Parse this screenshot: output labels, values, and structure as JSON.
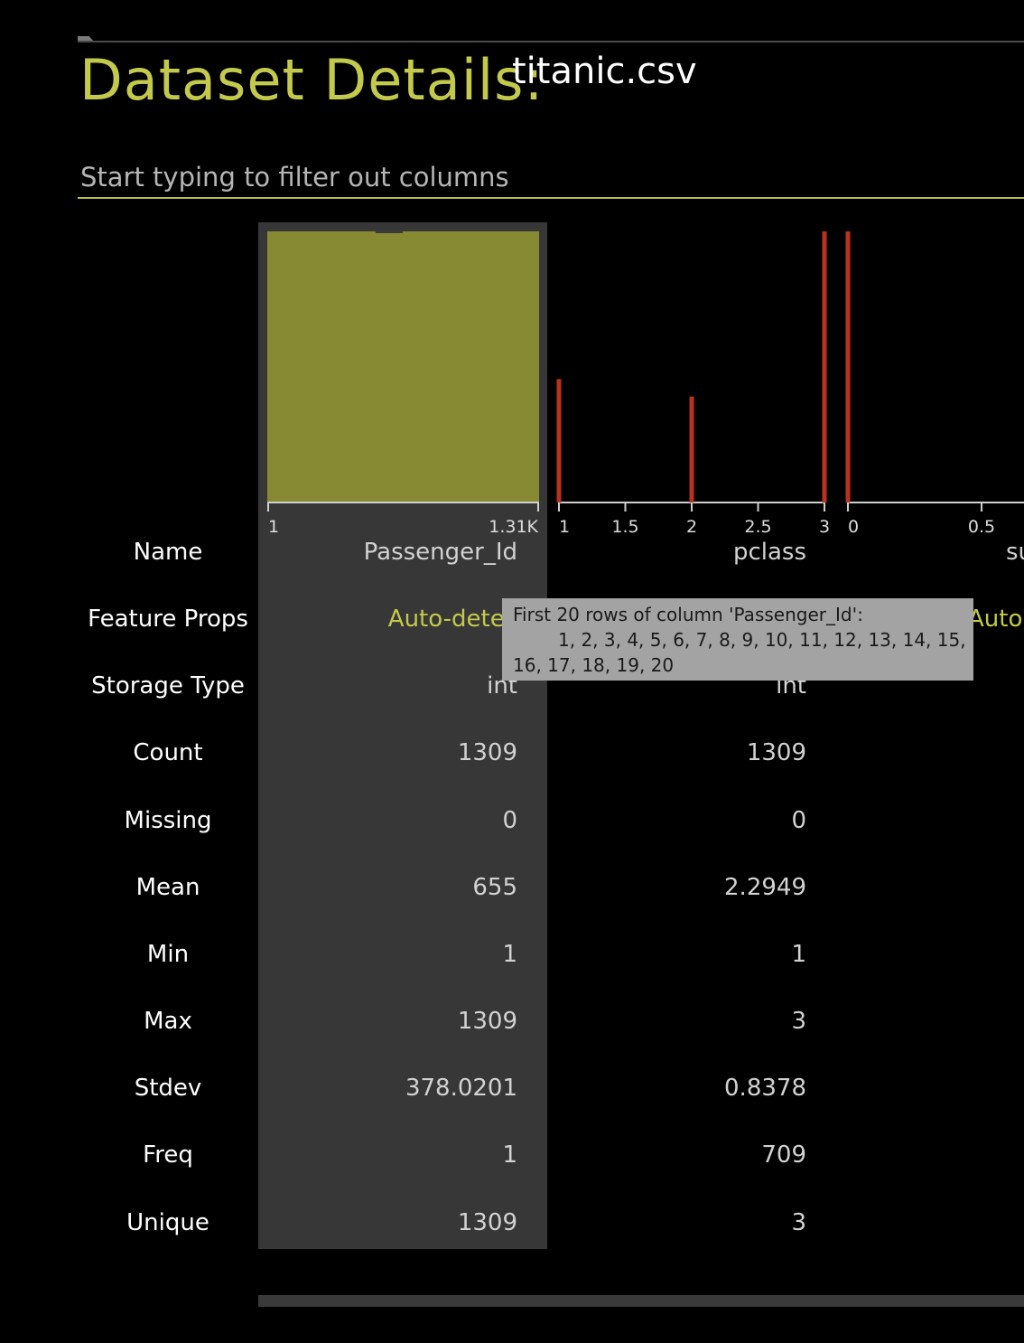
{
  "header": {
    "title": "Dataset Details:",
    "filename": "titanic.csv"
  },
  "filter": {
    "placeholder": "Start typing to filter out columns"
  },
  "row_labels": [
    "Name",
    "Feature Props",
    "Storage Type",
    "Count",
    "Missing",
    "Mean",
    "Min",
    "Max",
    "Stdev",
    "Freq",
    "Unique"
  ],
  "columns": [
    {
      "name": "Passenger_Id",
      "feature_props": "Auto-detec",
      "storage_type": "int",
      "count": "1309",
      "missing": "0",
      "mean": "655",
      "min": "1",
      "max": "1309",
      "stdev": "378.0201",
      "freq": "1",
      "unique": "1309"
    },
    {
      "name": "pclass",
      "feature_props": "",
      "storage_type": "int",
      "count": "1309",
      "missing": "0",
      "mean": "2.2949",
      "min": "1",
      "max": "3",
      "stdev": "0.8378",
      "freq": "709",
      "unique": "3"
    },
    {
      "name": "su",
      "feature_props": "Auto-"
    }
  ],
  "tooltip": {
    "line1": "First 20 rows of column 'Passenger_Id':",
    "line2": "1, 2, 3, 4, 5, 6, 7, 8, 9, 10, 11, 12, 13, 14, 15,",
    "line3": "16, 17, 18, 19, 20"
  },
  "colors": {
    "accent": "#c3c94a",
    "histogram_fill": "#878a33",
    "bar_red": "#b8321f",
    "highlight_bg": "#373737"
  },
  "chart_data": [
    {
      "type": "bar",
      "column": "Passenger_Id",
      "ticks": [
        "1",
        "1.31K"
      ],
      "bins": [
        {
          "from": 1,
          "to": 1309,
          "count": 1309
        }
      ]
    },
    {
      "type": "bar",
      "column": "pclass",
      "ticks": [
        "1",
        "1.5",
        "2",
        "2.5",
        "3"
      ],
      "x": [
        1,
        2,
        3
      ],
      "values": [
        323,
        277,
        709
      ],
      "xlim": [
        1,
        3
      ]
    },
    {
      "type": "bar",
      "column": "su",
      "ticks": [
        "0",
        "0.5"
      ],
      "x": [
        0
      ],
      "values": [
        809
      ],
      "xlim": [
        0,
        1
      ]
    }
  ]
}
